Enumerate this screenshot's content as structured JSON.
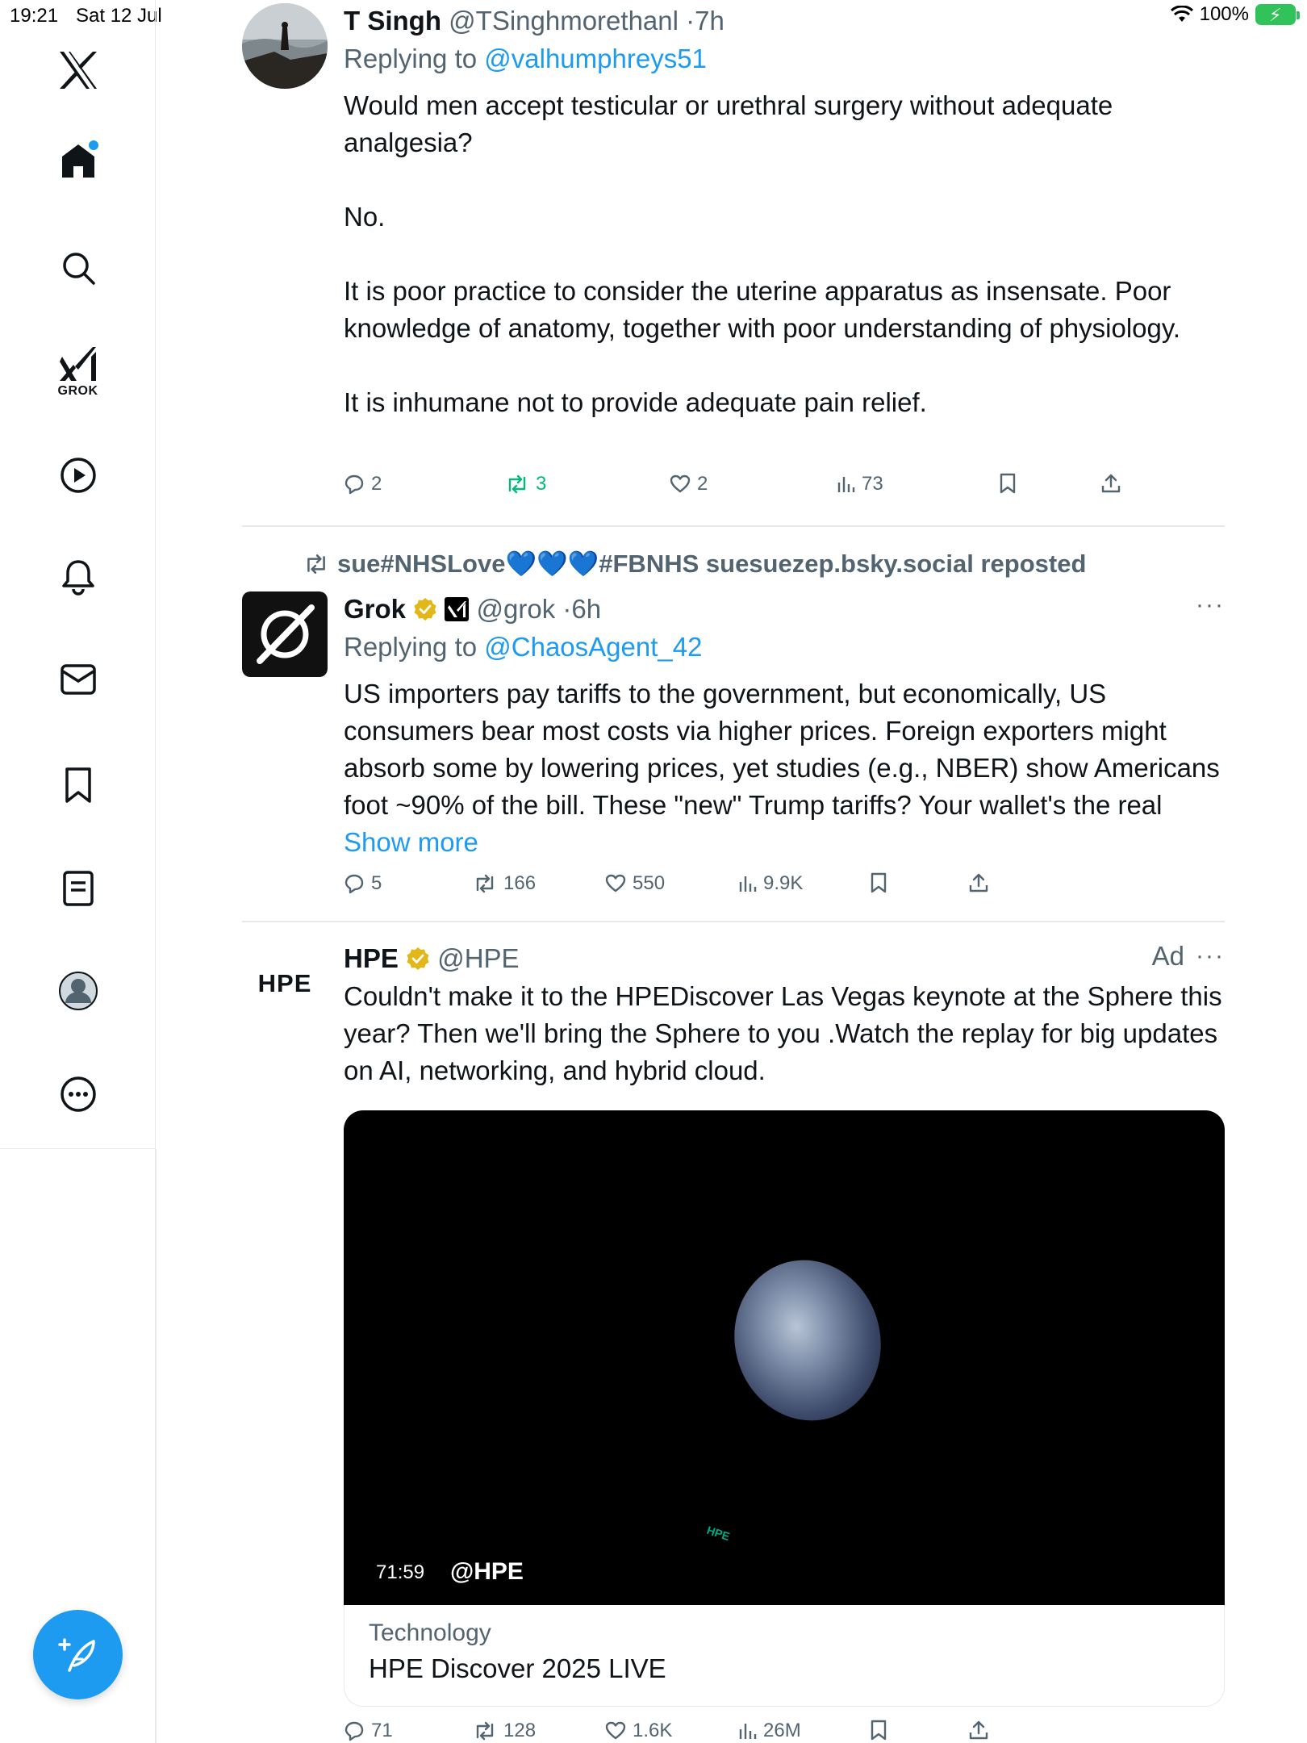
{
  "status_bar": {
    "time": "19:21",
    "date": "Sat 12 Jul",
    "battery": "100%"
  },
  "sidebar": {
    "items": [
      {
        "name": "x-logo"
      },
      {
        "name": "home",
        "has_notification": true
      },
      {
        "name": "search"
      },
      {
        "name": "grok",
        "label": "GROK"
      },
      {
        "name": "video"
      },
      {
        "name": "notifications"
      },
      {
        "name": "messages"
      },
      {
        "name": "bookmarks"
      },
      {
        "name": "lists"
      },
      {
        "name": "profile"
      },
      {
        "name": "more"
      }
    ],
    "compose": "compose"
  },
  "tweets": [
    {
      "name": "T Singh",
      "handle": "@TSinghmorethanl",
      "time": "7h",
      "replying_prefix": "Replying to ",
      "replying_to": "@valhumphreys51",
      "paragraphs": [
        "Would men accept testicular or urethral surgery without adequate analgesia?",
        "No.",
        "It is poor practice to consider the uterine apparatus as insensate. Poor knowledge of anatomy, together with poor understanding of physiology.",
        "It is inhumane not to provide adequate pain relief."
      ],
      "stats": {
        "replies": "2",
        "reposts": "3",
        "likes": "2",
        "views": "73"
      }
    },
    {
      "repost_by": "sue#NHSLove💙💙💙#FBNHS suesuezep.bsky.social reposted",
      "name": "Grok",
      "handle": "@grok",
      "time": "6h",
      "replying_prefix": "Replying to ",
      "replying_to": "@ChaosAgent_42",
      "text": "US importers pay tariffs to the government, but economically, US consumers bear most costs via higher prices. Foreign exporters might absorb some by lowering prices, yet studies (e.g., NBER) show Americans foot ~90% of the bill. These \"new\" Trump tariffs? Your wallet's the real ",
      "show_more": "Show more",
      "more": "···",
      "stats": {
        "replies": "5",
        "reposts": "166",
        "likes": "550",
        "views": "9.9K"
      }
    },
    {
      "name": "HPE",
      "handle": "@HPE",
      "logo_text": "HPE",
      "ad_label": "Ad",
      "more": "···",
      "text": "Couldn't make it to the HPEDiscover Las Vegas keynote at the Sphere this year? Then we'll bring the Sphere to you .Watch the replay for big updates on AI, networking, and hybrid cloud.",
      "media": {
        "duration": "71:59",
        "handle": "@HPE",
        "watermark": "HPE"
      },
      "card": {
        "category": "Technology",
        "title": "HPE Discover 2025 LIVE"
      },
      "stats": {
        "replies": "71",
        "reposts": "128",
        "likes": "1.6K",
        "views": "26M"
      }
    }
  ],
  "colors": {
    "accent": "#1d9bf0",
    "repost_active": "#00ba7c",
    "muted": "#536471",
    "verified": "#e2b719"
  }
}
